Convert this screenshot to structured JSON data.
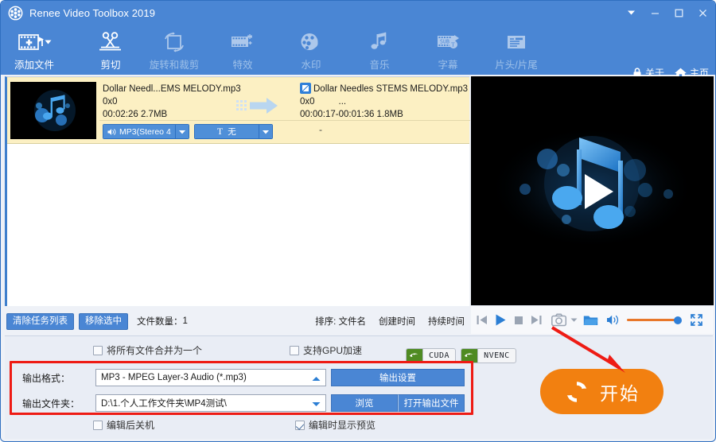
{
  "window": {
    "title": "Renee Video Toolbox 2019",
    "logo_icon": "film-reel-icon",
    "controls": [
      {
        "name": "menu-dropdown-button",
        "icon": "chevron-down-filled-icon"
      },
      {
        "name": "minimize-button",
        "icon": "minimize-icon"
      },
      {
        "name": "maximize-button",
        "icon": "maximize-icon"
      },
      {
        "name": "close-button",
        "icon": "close-icon"
      }
    ]
  },
  "ribbon": {
    "items": [
      {
        "label": "添加文件",
        "icon": "add-file-icon",
        "enabled": true,
        "has_dropdown": true
      },
      {
        "label": "剪切",
        "icon": "scissors-icon",
        "enabled": true,
        "has_dropdown": false
      },
      {
        "label": "旋转和裁剪",
        "icon": "rotate-crop-icon",
        "enabled": false,
        "has_dropdown": false
      },
      {
        "label": "特效",
        "icon": "effects-film-icon",
        "enabled": false,
        "has_dropdown": false
      },
      {
        "label": "水印",
        "icon": "watermark-icon",
        "enabled": false,
        "has_dropdown": false
      },
      {
        "label": "音乐",
        "icon": "music-note-icon",
        "enabled": false,
        "has_dropdown": false
      },
      {
        "label": "字幕",
        "icon": "subtitle-icon",
        "enabled": false,
        "has_dropdown": false
      },
      {
        "label": "片头/片尾",
        "icon": "intro-outro-icon",
        "enabled": false,
        "has_dropdown": false
      }
    ],
    "links": [
      {
        "label": "关于",
        "icon": "lock-icon"
      },
      {
        "label": "主页",
        "icon": "home-icon"
      }
    ]
  },
  "file_list": {
    "rows": [
      {
        "thumbnail_icon": "music-note-thumbnail",
        "source": {
          "name": "Dollar Needl...EMS MELODY.mp3",
          "resolution": "0x0",
          "duration_size": "00:02:26  2.7MB"
        },
        "transfer_icon": "arrow-right-icon",
        "target": {
          "edit_badge_icon": "edit-pencil-icon",
          "name": "Dollar Needles STEMS MELODY.mp3",
          "resolution": "0x0",
          "ellipsis": "...",
          "duration_size": "00:00:17-00:01:36  1.8MB"
        },
        "audio_track": {
          "icon": "speaker-icon",
          "label": "MP3(Stereo 4"
        },
        "subtitle_track": {
          "icon": "text-t-icon",
          "label": "无"
        },
        "extra": "-"
      }
    ]
  },
  "list_toolbar": {
    "clear_list_label": "清除任务列表",
    "remove_selected_label": "移除选中",
    "count_label": "文件数量：",
    "count_value": "1",
    "sort_label": "排序:",
    "sort_options": [
      "文件名",
      "创建时间",
      "持续时间"
    ]
  },
  "player": {
    "buttons": [
      {
        "name": "previous-button",
        "icon": "skip-previous-icon"
      },
      {
        "name": "play-button",
        "icon": "play-icon"
      },
      {
        "name": "stop-button",
        "icon": "stop-icon"
      },
      {
        "name": "next-button",
        "icon": "skip-next-icon"
      },
      {
        "name": "snapshot-button",
        "icon": "camera-icon"
      },
      {
        "name": "snapshot-dropdown",
        "icon": "chevron-down-icon"
      },
      {
        "name": "open-folder-button",
        "icon": "folder-icon"
      },
      {
        "name": "volume-button",
        "icon": "speaker-icon"
      },
      {
        "name": "fullscreen-button",
        "icon": "fullscreen-icon"
      }
    ],
    "volume_level": 100
  },
  "settings": {
    "merge_all_label": "将所有文件合并为一个",
    "merge_all_checked": false,
    "gpu_accel_label": "支持GPU加速",
    "gpu_accel_checked": false,
    "badges": [
      {
        "label": "CUDA",
        "icon": "nvidia-icon"
      },
      {
        "label": "NVENC",
        "icon": "nvidia-icon"
      }
    ],
    "output_format_label": "输出格式：",
    "output_format_value": "MP3 - MPEG Layer-3 Audio (*.mp3)",
    "output_format_arrow": "chevron-up-icon",
    "output_settings_label": "输出设置",
    "output_folder_label": "输出文件夹：",
    "output_folder_value": "D:\\1.个人工作文件夹\\MP4测试\\",
    "output_folder_arrow": "chevron-down-icon",
    "browse_label": "浏览",
    "open_output_label": "打开输出文件",
    "shutdown_label": "编辑后关机",
    "shutdown_checked": false,
    "preview_label": "编辑时显示预览",
    "preview_checked": true
  },
  "start_button": {
    "label": "开始",
    "icon": "refresh-circular-icon",
    "color": "#f28010"
  },
  "annotations": {
    "highlight_box_color": "#ee1b14",
    "arrow_color": "#ee1b14"
  }
}
